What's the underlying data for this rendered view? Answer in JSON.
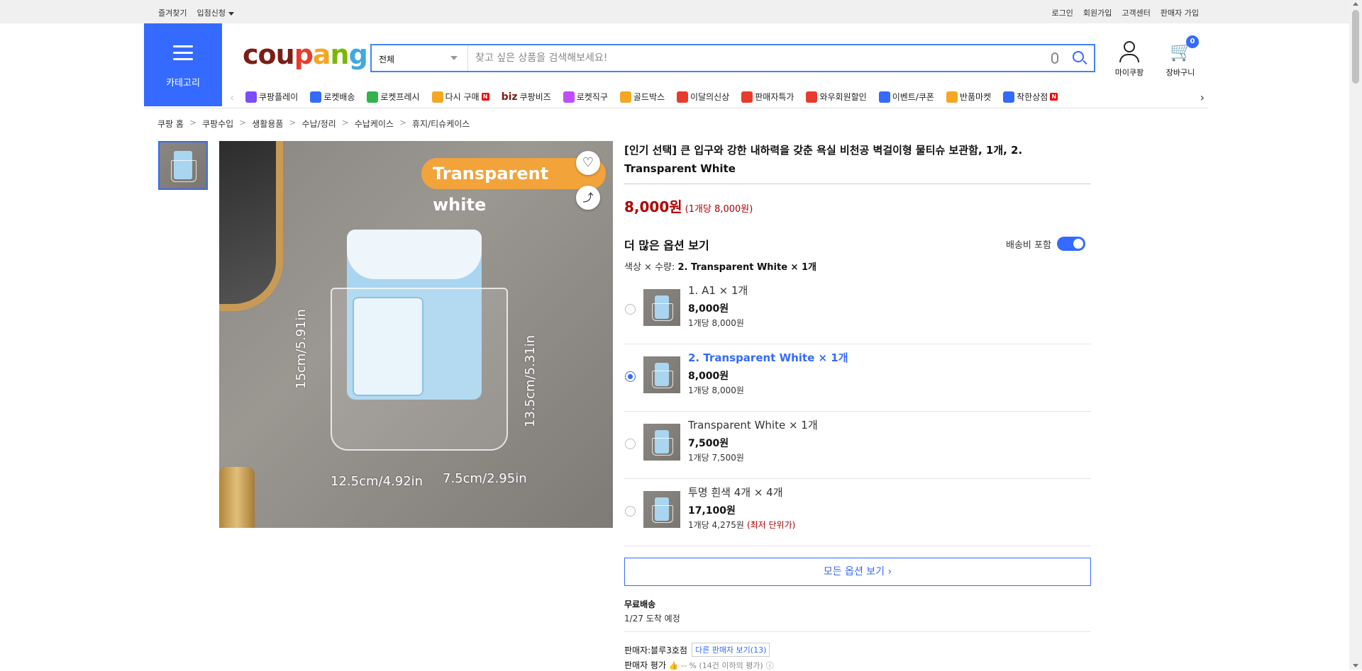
{
  "topbar": {
    "left": [
      "즐겨찾기",
      "입점신청"
    ],
    "right": [
      "로그인",
      "회원가입",
      "고객센터",
      "판매자 가입"
    ]
  },
  "header": {
    "category_label": "카테고리",
    "logo": [
      "cou",
      "p",
      "a",
      "n",
      "g"
    ],
    "search_scope": "전체",
    "search_placeholder": "찾고 싶은 상품을 검색해보세요!",
    "mycoupang_label": "마이쿠팡",
    "cart_label": "장바구니",
    "cart_count": "0"
  },
  "nav": {
    "items": [
      {
        "label": "쿠팡플레이",
        "icon": "play-icon",
        "color": "#7b4dff"
      },
      {
        "label": "로켓배송",
        "icon": "rocket-icon",
        "color": "#346aff"
      },
      {
        "label": "로켓프레시",
        "icon": "rocket-fresh-icon",
        "color": "#33b34a"
      },
      {
        "label": "다시 구매",
        "icon": "rebuy-icon",
        "color": "#f5a623",
        "badge": "N"
      },
      {
        "label": "쿠팡비즈",
        "icon": "biz-icon",
        "color": "#7b1e16",
        "prefix": "biz"
      },
      {
        "label": "로켓직구",
        "icon": "rocket-global-icon",
        "color": "#c04cff"
      },
      {
        "label": "골드박스",
        "icon": "goldbox-icon",
        "color": "#f5a623"
      },
      {
        "label": "이달의신상",
        "icon": "new-icon",
        "color": "#e93b2b"
      },
      {
        "label": "판매자특가",
        "icon": "percent-icon",
        "color": "#e93b2b"
      },
      {
        "label": "와우회원할인",
        "icon": "wow-icon",
        "color": "#e93b2b"
      },
      {
        "label": "이벤트/쿠폰",
        "icon": "coupon-icon",
        "color": "#346aff"
      },
      {
        "label": "반품마켓",
        "icon": "return-market-icon",
        "color": "#f5a623"
      },
      {
        "label": "착한상점",
        "icon": "good-store-icon",
        "color": "#346aff",
        "badge": "N"
      }
    ]
  },
  "breadcrumb": [
    "쿠팡 홈",
    "쿠팡수입",
    "생활용품",
    "수납/정리",
    "수납케이스",
    "휴지/티슈케이스"
  ],
  "photo": {
    "tag": "Transparent white",
    "dim_h1": "15cm/5.91in",
    "dim_h2": "13.5cm/5.31in",
    "dim_w1": "12.5cm/4.92in",
    "dim_w2": "7.5cm/2.95in"
  },
  "product": {
    "title": "[인기 선택] 큰 입구와 강한 내하력을 갖춘 욕실 비천공 벽걸이형 물티슈 보관함, 1개, 2. Transparent White",
    "price": "8,000원",
    "unit_price": "(1개당 8,000원)",
    "more_options": "더 많은 옵션 보기",
    "shipping_toggle": "배송비 포함",
    "selection_label": "색상 × 수량: ",
    "selection_value": "2. Transparent White × 1개",
    "options": [
      {
        "name": "1. A1 × 1개",
        "price": "8,000원",
        "unit": "1개당 8,000원",
        "selected": false,
        "low": ""
      },
      {
        "name": "2. Transparent White × 1개",
        "price": "8,000원",
        "unit": "1개당 8,000원",
        "selected": true,
        "low": ""
      },
      {
        "name": "Transparent White × 1개",
        "price": "7,500원",
        "unit": "1개당 7,500원",
        "selected": false,
        "low": ""
      },
      {
        "name": "투명 흰색 4개 × 4개",
        "price": "17,100원",
        "unit": "1개당 4,275원",
        "selected": false,
        "low": "(최저 단위가)"
      }
    ],
    "all_options": "모든 옵션 보기 ›",
    "free_shipping": "무료배송",
    "arrival": "1/27 도착 예정",
    "seller_label": "판매자:블루3호점",
    "other_sellers": "다른 판매자 보기(13)",
    "seller_rating_label": "판매자 평가",
    "seller_rating_value": "-- % (14건 이하의 평가)"
  }
}
